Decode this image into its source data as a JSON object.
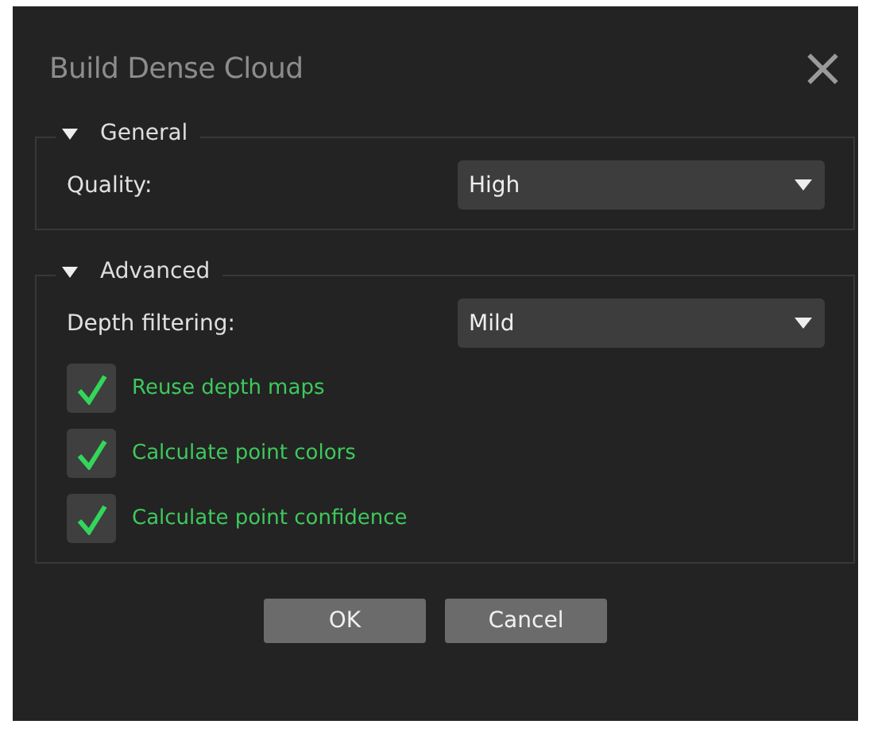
{
  "window": {
    "title": "Build Dense Cloud",
    "close": "×"
  },
  "sections": [
    {
      "title": "General",
      "expanded": true,
      "fields": [
        {
          "label": "Quality:",
          "value": "High"
        }
      ]
    },
    {
      "title": "Advanced",
      "expanded": true,
      "fields": [
        {
          "label": "Depth filtering:",
          "value": "Mild"
        }
      ],
      "checkboxes": [
        {
          "label": "Reuse depth maps",
          "checked": true
        },
        {
          "label": "Calculate point colors",
          "checked": true
        },
        {
          "label": "Calculate point confidence",
          "checked": true
        }
      ]
    }
  ],
  "buttons": [
    "OK",
    "Cancel"
  ]
}
